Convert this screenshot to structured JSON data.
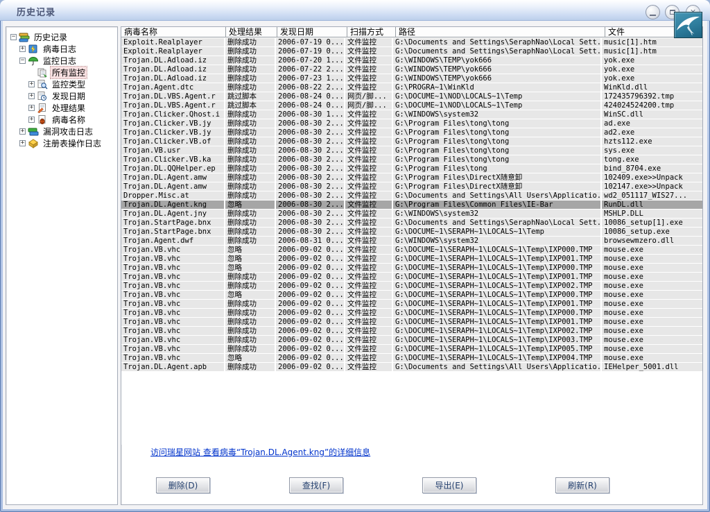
{
  "colors": {
    "title_text": "#4d5878",
    "link": "#0033cc",
    "row_bg": "#e7e7e7",
    "row_selected_bg": "#a6a6a6",
    "tree_selected_bg": "#f7dfe0",
    "logo_bg": "#2e7d9d",
    "button_text": "#24406e"
  },
  "titlebar": {
    "title": "历史记录",
    "buttons": [
      {
        "id": "minimize",
        "icon": "minimize-icon"
      },
      {
        "id": "restore",
        "icon": "restore-icon"
      },
      {
        "id": "close",
        "icon": "close-icon"
      }
    ],
    "logo_icon": "rising-swallow-logo"
  },
  "sidebar": {
    "items": [
      {
        "id": "history-root",
        "label": "历史记录",
        "level": 0,
        "expander": "minus",
        "icon": "history-books-icon",
        "selected": false
      },
      {
        "id": "virus-log",
        "label": "病毒日志",
        "level": 1,
        "expander": "plus",
        "icon": "virus-log-icon",
        "selected": false
      },
      {
        "id": "monitor-log",
        "label": "监控日志",
        "level": 1,
        "expander": "minus",
        "icon": "monitor-umbrella-icon",
        "selected": false
      },
      {
        "id": "all-monitors",
        "label": "所有监控",
        "level": 2,
        "expander": "none",
        "icon": "all-monitor-icon",
        "selected": true
      },
      {
        "id": "monitor-type",
        "label": "监控类型",
        "level": 2,
        "expander": "plus",
        "icon": "monitor-type-icon",
        "selected": false
      },
      {
        "id": "found-date",
        "label": "发现日期",
        "level": 2,
        "expander": "plus",
        "icon": "found-date-icon",
        "selected": false
      },
      {
        "id": "handle-result",
        "label": "处理结果",
        "level": 2,
        "expander": "plus",
        "icon": "handle-result-icon",
        "selected": false
      },
      {
        "id": "virus-name",
        "label": "病毒名称",
        "level": 2,
        "expander": "plus",
        "icon": "virus-name-icon",
        "selected": false
      },
      {
        "id": "vuln-log",
        "label": "漏洞攻击日志",
        "level": 1,
        "expander": "plus",
        "icon": "vuln-log-icon",
        "selected": false
      },
      {
        "id": "registry-log",
        "label": "注册表操作日志",
        "level": 1,
        "expander": "plus",
        "icon": "registry-log-icon",
        "selected": false
      }
    ]
  },
  "table": {
    "columns": [
      {
        "id": "virus-name",
        "label": "病毒名称"
      },
      {
        "id": "result",
        "label": "处理结果"
      },
      {
        "id": "found-date",
        "label": "发现日期"
      },
      {
        "id": "scan-mode",
        "label": "扫描方式"
      },
      {
        "id": "path",
        "label": "路径"
      },
      {
        "id": "file",
        "label": "文件"
      }
    ],
    "selected_row_index": 18,
    "rows": [
      [
        "Exploit.Realplayer",
        "删除成功",
        "2006-07-19 0...",
        "文件监控",
        "G:\\Documents and Settings\\SeraphNao\\Local Sett...",
        "music[1].htm"
      ],
      [
        "Exploit.Realplayer",
        "删除成功",
        "2006-07-19 0...",
        "文件监控",
        "G:\\Documents and Settings\\SeraphNao\\Local Sett...",
        "music[1].htm"
      ],
      [
        "Trojan.DL.Adload.iz",
        "删除成功",
        "2006-07-20 1...",
        "文件监控",
        "G:\\WINDOWS\\TEMP\\yok666",
        "yok.exe"
      ],
      [
        "Trojan.DL.Adload.iz",
        "删除成功",
        "2006-07-22 2...",
        "文件监控",
        "G:\\WINDOWS\\TEMP\\yok666",
        "yok.exe"
      ],
      [
        "Trojan.DL.Adload.iz",
        "删除成功",
        "2006-07-23 1...",
        "文件监控",
        "G:\\WINDOWS\\TEMP\\yok666",
        "yok.exe"
      ],
      [
        "Trojan.Agent.dtc",
        "删除成功",
        "2006-08-22 2...",
        "文件监控",
        "G:\\PROGRA~1\\WinKld",
        "WinKld.dll"
      ],
      [
        "Trojan.DL.VBS.Agent.r",
        "跳过脚本",
        "2006-08-24 0...",
        "网页/脚...",
        "G:\\DOCUME~1\\NOD\\LOCALS~1\\Temp",
        "172435796392.tmp"
      ],
      [
        "Trojan.DL.VBS.Agent.r",
        "跳过脚本",
        "2006-08-24 0...",
        "网页/脚...",
        "G:\\DOCUME~1\\NOD\\LOCALS~1\\Temp",
        "424024524200.tmp"
      ],
      [
        "Trojan.Clicker.Qhost.i",
        "删除成功",
        "2006-08-30 1...",
        "文件监控",
        "G:\\WINDOWS\\system32",
        "WinSC.dll"
      ],
      [
        "Trojan.Clicker.VB.jy",
        "删除成功",
        "2006-08-30 2...",
        "文件监控",
        "G:\\Program Files\\tong\\tong",
        "ad.exe"
      ],
      [
        "Trojan.Clicker.VB.jy",
        "删除成功",
        "2006-08-30 2...",
        "文件监控",
        "G:\\Program Files\\tong\\tong",
        "ad2.exe"
      ],
      [
        "Trojan.Clicker.VB.of",
        "删除成功",
        "2006-08-30 2...",
        "文件监控",
        "G:\\Program Files\\tong\\tong",
        "hzts112.exe"
      ],
      [
        "Trojan.VB.usr",
        "删除成功",
        "2006-08-30 2...",
        "文件监控",
        "G:\\Program Files\\tong\\tong",
        "sys.exe"
      ],
      [
        "Trojan.Clicker.VB.ka",
        "删除成功",
        "2006-08-30 2...",
        "文件监控",
        "G:\\Program Files\\tong\\tong",
        "tong.exe"
      ],
      [
        "Trojan.DL.QQHelper.ep",
        "删除成功",
        "2006-08-30 2...",
        "文件监控",
        "G:\\Program Files\\tong",
        "bind_8704.exe"
      ],
      [
        "Trojan.DL.Agent.amw",
        "删除成功",
        "2006-08-30 2...",
        "文件监控",
        "G:\\Program Files\\DirectX随意卸",
        "102409.exe>>Unpack"
      ],
      [
        "Trojan.DL.Agent.amw",
        "删除成功",
        "2006-08-30 2...",
        "文件监控",
        "G:\\Program Files\\DirectX随意卸",
        "102147.exe>>Unpack"
      ],
      [
        "Dropper.Misc.at",
        "删除成功",
        "2006-08-30 2...",
        "文件监控",
        "G:\\Documents and Settings\\All Users\\Applicatio...",
        "wd2_051117_WIS27..."
      ],
      [
        "Trojan.DL.Agent.kng",
        "忽略",
        "2006-08-30 2...",
        "文件监控",
        "G:\\Program Files\\Common Files\\IE-Bar",
        "RunDL.dll"
      ],
      [
        "Trojan.DL.Agent.jny",
        "删除成功",
        "2006-08-30 2...",
        "文件监控",
        "G:\\WINDOWS\\system32",
        "MSHLP.DLL"
      ],
      [
        "Trojan.StartPage.bnx",
        "删除成功",
        "2006-08-30 2...",
        "文件监控",
        "G:\\Documents and Settings\\SeraphNao\\Local Sett...",
        "10086_setup[1].exe"
      ],
      [
        "Trojan.StartPage.bnx",
        "删除成功",
        "2006-08-30 2...",
        "文件监控",
        "G:\\DOCUME~1\\SERAPH~1\\LOCALS~1\\Temp",
        "10086_setup.exe"
      ],
      [
        "Trojan.Agent.dwf",
        "删除成功",
        "2006-08-31 0...",
        "文件监控",
        "G:\\WINDOWS\\system32",
        "browsewmzero.dll"
      ],
      [
        "Trojan.VB.vhc",
        "忽略",
        "2006-09-02 0...",
        "文件监控",
        "G:\\DOCUME~1\\SERAPH~1\\LOCALS~1\\Temp\\IXP000.TMP",
        "mouse.exe"
      ],
      [
        "Trojan.VB.vhc",
        "忽略",
        "2006-09-02 0...",
        "文件监控",
        "G:\\DOCUME~1\\SERAPH~1\\LOCALS~1\\Temp\\IXP001.TMP",
        "mouse.exe"
      ],
      [
        "Trojan.VB.vhc",
        "忽略",
        "2006-09-02 0...",
        "文件监控",
        "G:\\DOCUME~1\\SERAPH~1\\LOCALS~1\\Temp\\IXP000.TMP",
        "mouse.exe"
      ],
      [
        "Trojan.VB.vhc",
        "删除成功",
        "2006-09-02 0...",
        "文件监控",
        "G:\\DOCUME~1\\SERAPH~1\\LOCALS~1\\Temp\\IXP001.TMP",
        "mouse.exe"
      ],
      [
        "Trojan.VB.vhc",
        "删除成功",
        "2006-09-02 0...",
        "文件监控",
        "G:\\DOCUME~1\\SERAPH~1\\LOCALS~1\\Temp\\IXP002.TMP",
        "mouse.exe"
      ],
      [
        "Trojan.VB.vhc",
        "忽略",
        "2006-09-02 0...",
        "文件监控",
        "G:\\DOCUME~1\\SERAPH~1\\LOCALS~1\\Temp\\IXP000.TMP",
        "mouse.exe"
      ],
      [
        "Trojan.VB.vhc",
        "删除成功",
        "2006-09-02 0...",
        "文件监控",
        "G:\\DOCUME~1\\SERAPH~1\\LOCALS~1\\Temp\\IXP001.TMP",
        "mouse.exe"
      ],
      [
        "Trojan.VB.vhc",
        "删除成功",
        "2006-09-02 0...",
        "文件监控",
        "G:\\DOCUME~1\\SERAPH~1\\LOCALS~1\\Temp\\IXP000.TMP",
        "mouse.exe"
      ],
      [
        "Trojan.VB.vhc",
        "删除成功",
        "2006-09-02 0...",
        "文件监控",
        "G:\\DOCUME~1\\SERAPH~1\\LOCALS~1\\Temp\\IXP001.TMP",
        "mouse.exe"
      ],
      [
        "Trojan.VB.vhc",
        "删除成功",
        "2006-09-02 0...",
        "文件监控",
        "G:\\DOCUME~1\\SERAPH~1\\LOCALS~1\\Temp\\IXP002.TMP",
        "mouse.exe"
      ],
      [
        "Trojan.VB.vhc",
        "删除成功",
        "2006-09-02 0...",
        "文件监控",
        "G:\\DOCUME~1\\SERAPH~1\\LOCALS~1\\Temp\\IXP003.TMP",
        "mouse.exe"
      ],
      [
        "Trojan.VB.vhc",
        "删除成功",
        "2006-09-02 0...",
        "文件监控",
        "G:\\DOCUME~1\\SERAPH~1\\LOCALS~1\\Temp\\IXP005.TMP",
        "mouse.exe"
      ],
      [
        "Trojan.VB.vhc",
        "忽略",
        "2006-09-02 0...",
        "文件监控",
        "G:\\DOCUME~1\\SERAPH~1\\LOCALS~1\\Temp\\IXP004.TMP",
        "mouse.exe"
      ],
      [
        "Trojan.DL.Agent.apb",
        "删除成功",
        "2006-09-02 0...",
        "文件监控",
        "G:\\Documents and Settings\\All Users\\Applicatio...",
        "IEHelper_5001.dll"
      ]
    ]
  },
  "footer": {
    "detail_link": "访问瑞星网站 查看病毒“Trojan.DL.Agent.kng”的详细信息",
    "buttons": [
      {
        "id": "delete-button",
        "label": "删除(D)"
      },
      {
        "id": "find-button",
        "label": "查找(F)"
      },
      {
        "id": "export-button",
        "label": "导出(E)"
      },
      {
        "id": "refresh-button",
        "label": "刷新(R)"
      }
    ]
  }
}
